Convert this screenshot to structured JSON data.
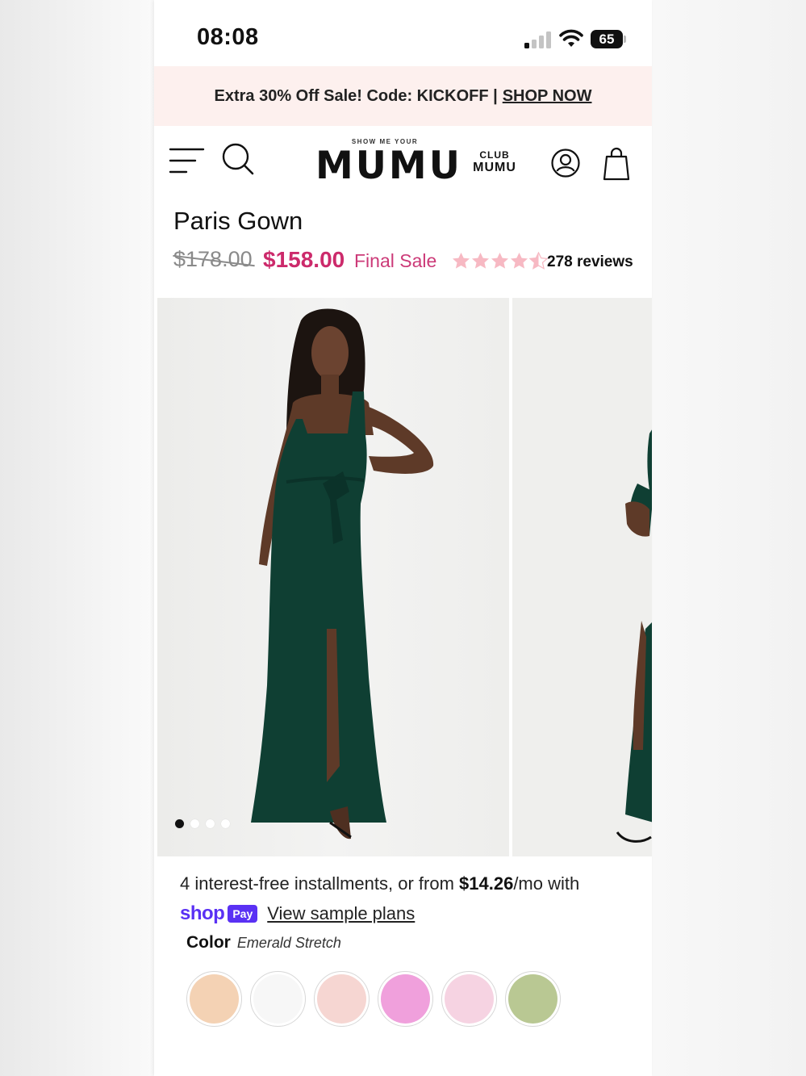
{
  "status_bar": {
    "time": "08:08",
    "battery": "65"
  },
  "promo": {
    "text": "Extra 30% Off Sale! Code: KICKOFF |",
    "link": "SHOP NOW"
  },
  "header": {
    "logo_top": "SHOW ME YOUR",
    "logo_main": "MUMU",
    "club_top": "CLUB",
    "club_bottom": "MUMU"
  },
  "product": {
    "name": "Paris Gown",
    "original_price": "$178.00",
    "sale_price": "$158.00",
    "sale_note": "Final Sale",
    "rating": 4.5,
    "rating_max": 5,
    "reviews": "278 reviews",
    "gallery_slide_count": 4,
    "gallery_active_index": 0
  },
  "installments": {
    "text_before": "4 interest-free installments, or from ",
    "amount": "$14.26",
    "text_after": "/mo with",
    "shop_word": "shop",
    "pay_badge": "Pay",
    "link": "View sample plans"
  },
  "color": {
    "label": "Color",
    "selected": "Emerald Stretch",
    "swatches": [
      "#f4d2b4",
      "#f7f7f7",
      "#f6d6d2",
      "#f0a0dc",
      "#f6d3e2",
      "#b9c893"
    ]
  },
  "colors": {
    "accent_price": "#cc2a6b",
    "promo_bg": "#fdf0ee",
    "shop_pay": "#5a31f4",
    "star": "#f7b9c3",
    "dress": "#0f3f33"
  }
}
